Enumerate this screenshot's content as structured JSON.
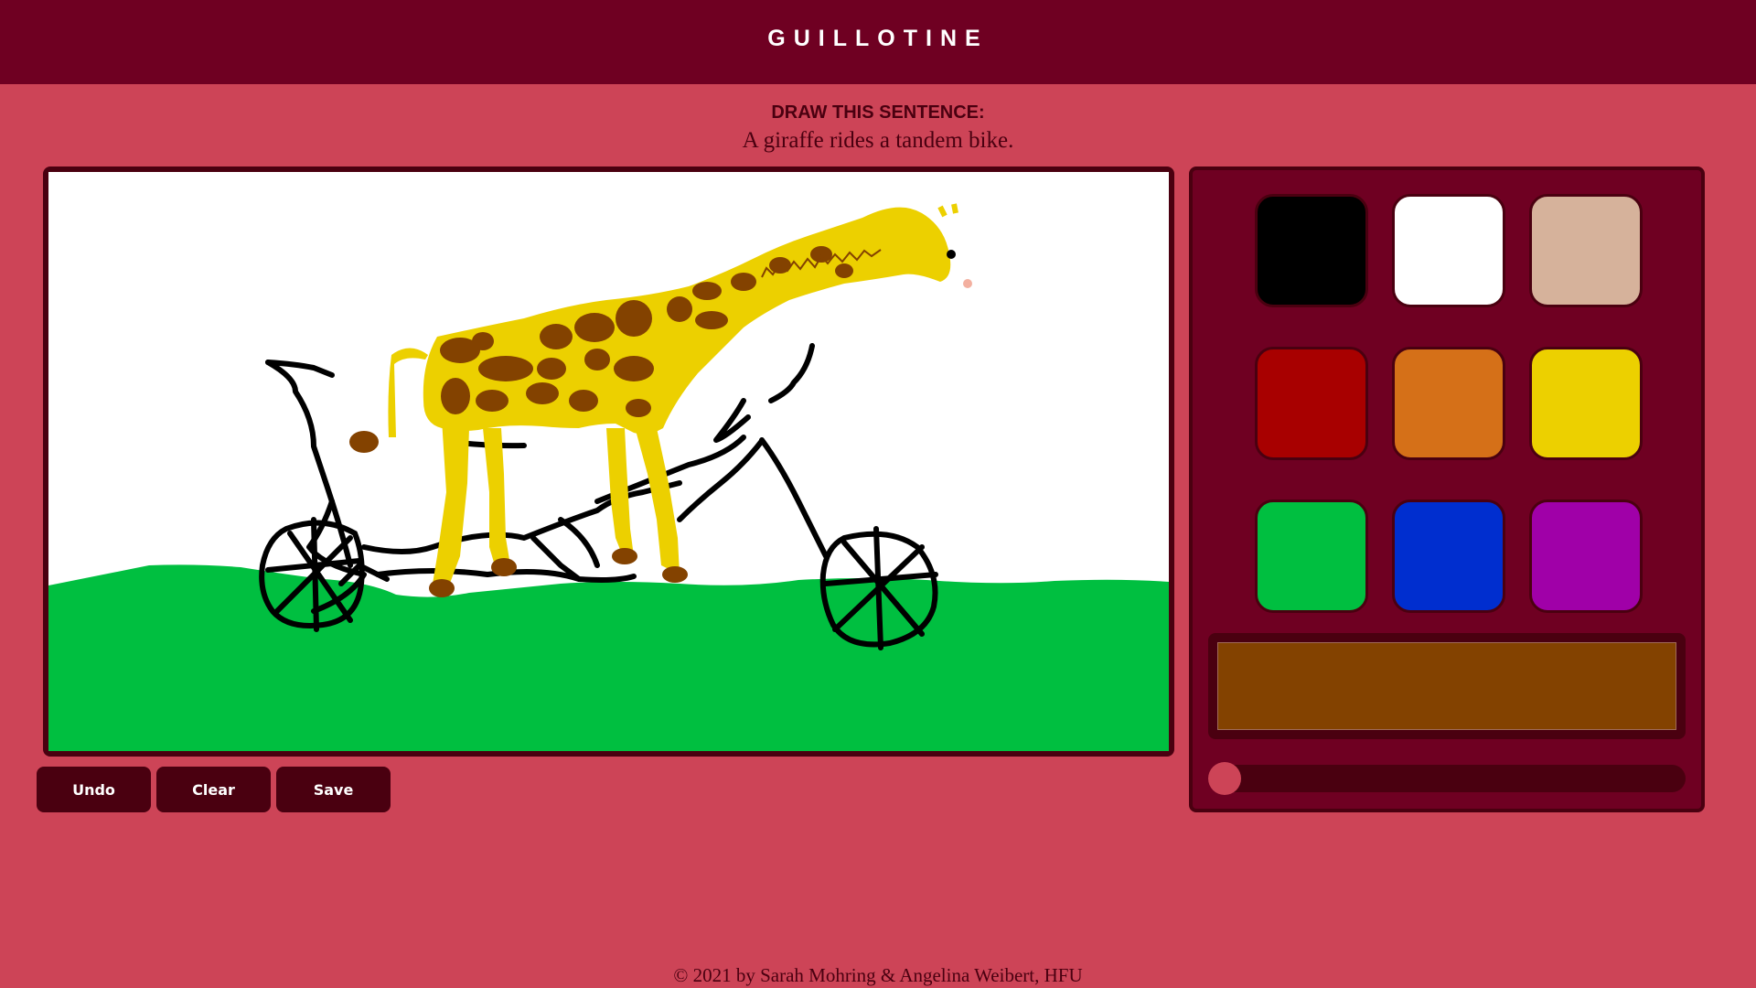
{
  "header": {
    "title": "GUILLOTINE"
  },
  "prompt": {
    "heading": "DRAW THIS SENTENCE:",
    "sentence": "A giraffe rides a tandem bike."
  },
  "toolbar": {
    "undo_label": "Undo",
    "clear_label": "Clear",
    "save_label": "Save"
  },
  "palette": {
    "colors": [
      {
        "name": "black",
        "hex": "#000000"
      },
      {
        "name": "white",
        "hex": "#ffffff"
      },
      {
        "name": "beige",
        "hex": "#d6b29b"
      },
      {
        "name": "red",
        "hex": "#a80000"
      },
      {
        "name": "orange",
        "hex": "#d57018"
      },
      {
        "name": "yellow",
        "hex": "#ecd000"
      },
      {
        "name": "green",
        "hex": "#00bf40"
      },
      {
        "name": "blue",
        "hex": "#002ecf"
      },
      {
        "name": "purple",
        "hex": "#a000a8"
      }
    ],
    "selected_color": "#834200",
    "brush_size_fraction": 0.0
  },
  "footer": {
    "copyright": "© 2021 by Sarah Mohring & Angelina Weibert, HFU"
  }
}
